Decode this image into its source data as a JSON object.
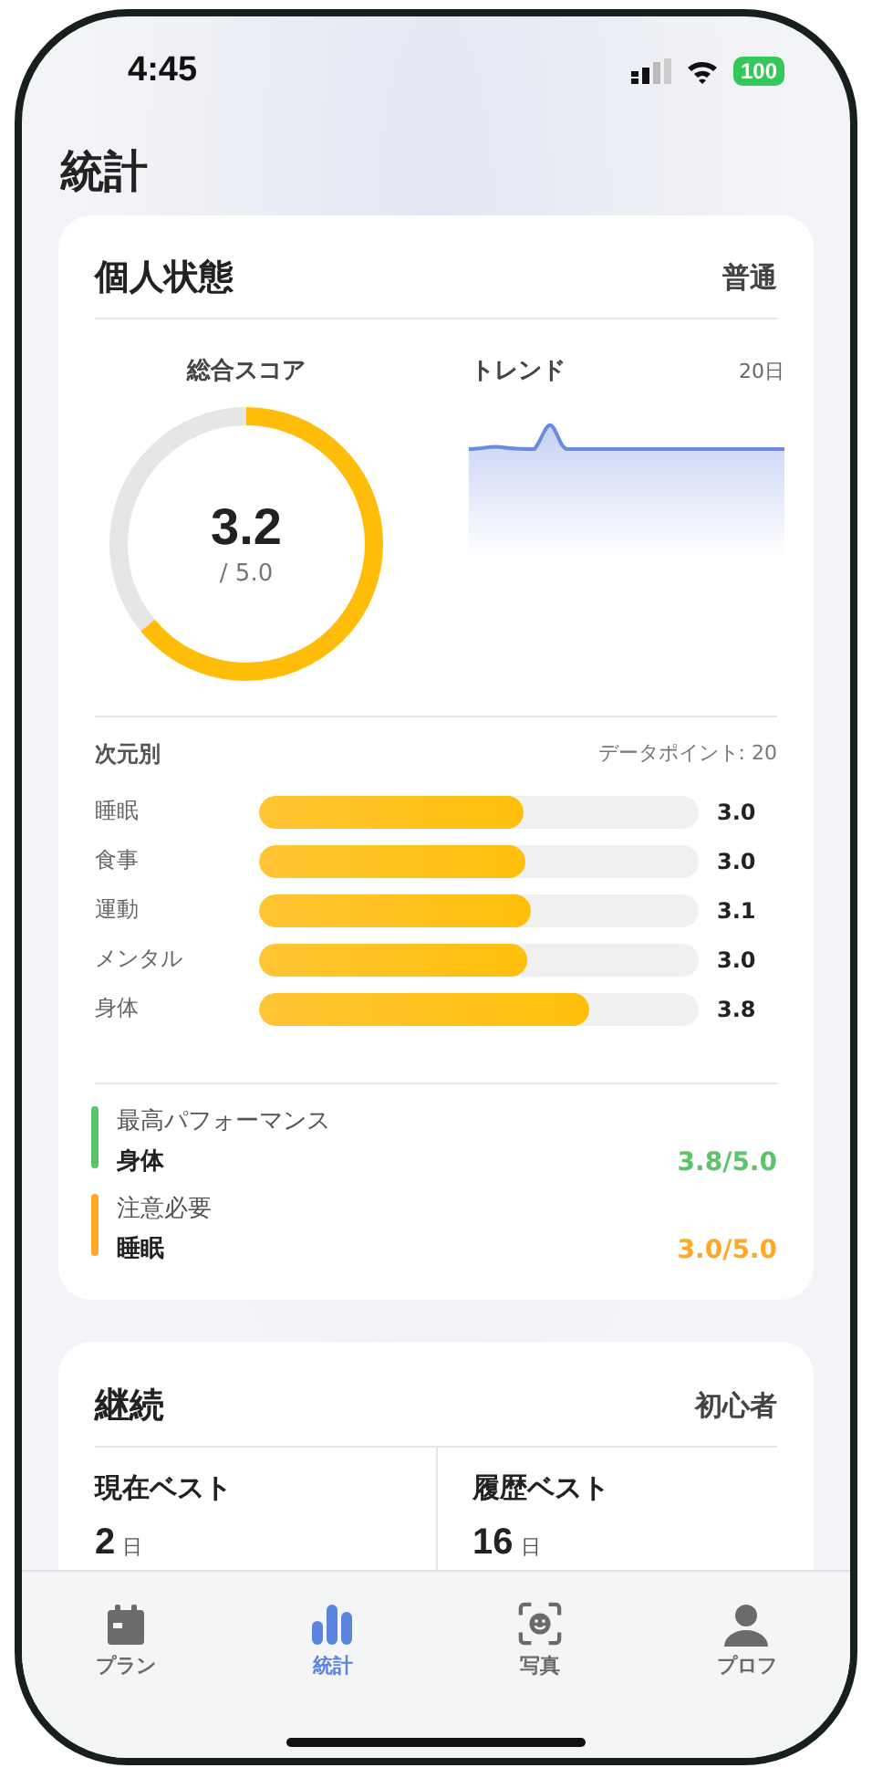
{
  "status_bar": {
    "time": "4:45",
    "battery": "100"
  },
  "title": "統計",
  "status_card": {
    "title": "個人状態",
    "badge": "普通",
    "score": {
      "label": "総合スコア",
      "value": "3.2",
      "max": "/ 5.0"
    },
    "trend": {
      "label": "トレンド",
      "range": "20日"
    },
    "dimensions": {
      "title": "次元別",
      "count": "データポイント: 20",
      "rows": [
        {
          "name": "睡眠",
          "level": 0.6,
          "value": "3.0"
        },
        {
          "name": "食事",
          "level": 0.605,
          "value": "3.0"
        },
        {
          "name": "運動",
          "level": 0.62,
          "value": "3.1"
        },
        {
          "name": "メンタル",
          "level": 0.61,
          "value": "3.0"
        },
        {
          "name": "身体",
          "level": 0.75,
          "value": "3.8"
        }
      ]
    },
    "highlights": [
      {
        "label": "最高パフォーマンス",
        "name": "身体",
        "score": "3.8/5.0",
        "color": "#5cc36b"
      },
      {
        "label": "注意必要",
        "name": "睡眠",
        "score": "3.0/5.0",
        "color": "#ffa726"
      }
    ]
  },
  "streak_card": {
    "title": "継続",
    "badge": "初心者",
    "stats": [
      {
        "label": "現在ベスト",
        "value": "2",
        "unit": "日"
      },
      {
        "label": "履歴ベスト",
        "value": "16",
        "unit": "日"
      }
    ]
  },
  "tabs": [
    {
      "label": "プラン",
      "kind": "calendar",
      "selected": false
    },
    {
      "label": "統計",
      "kind": "chart",
      "selected": true
    },
    {
      "label": "写真",
      "kind": "camera",
      "selected": false
    },
    {
      "label": "プロフ",
      "kind": "person",
      "selected": false
    }
  ]
}
